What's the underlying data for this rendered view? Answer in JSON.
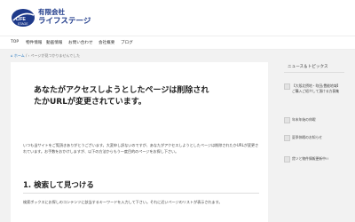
{
  "header": {
    "company_line1": "有限会社",
    "company_line2": "ライフステージ",
    "logo_text": "LIFE STAGE"
  },
  "nav": {
    "items": [
      "TOP",
      "物件情報",
      "動画情報",
      "お問い合わせ",
      "会社概要",
      "ブログ"
    ]
  },
  "breadcrumb": {
    "home": "ホーム",
    "separator": "/",
    "current": "ページが見つかりませんでした"
  },
  "main": {
    "headline": "あなたがアクセスしようとしたページは削除されたかURLが変更されています。",
    "intro": "いつも当サイトをご覧頂きありがとうございます。大変申し訳ないのですが、あなたがアクセスしようとしたページは削除されたかURLが変更されています。お手数をおかけしますが、以下の方法からもう一度目的のページをお探し下さい。",
    "section_title": "1. 検索して見つける",
    "section_desc": "検索ボックスにお探しのコンテンツに該当するキーワードを入力して下さい。それに近いページのリストが表示されます。"
  },
  "sidebar": {
    "title": "ニュース＆トピックス",
    "items": [
      "【大阪北摂地・吹田/豊能地域】ご購入ご紹介して頂ける方募集",
      "年末年始の休暇",
      "夏季休暇のお知らせ",
      "賃ソと物件情報更新中!!"
    ]
  },
  "colors": {
    "brand_blue": "#1e3a8a",
    "link_blue": "#1e73be",
    "background": "#f2f2f2"
  }
}
